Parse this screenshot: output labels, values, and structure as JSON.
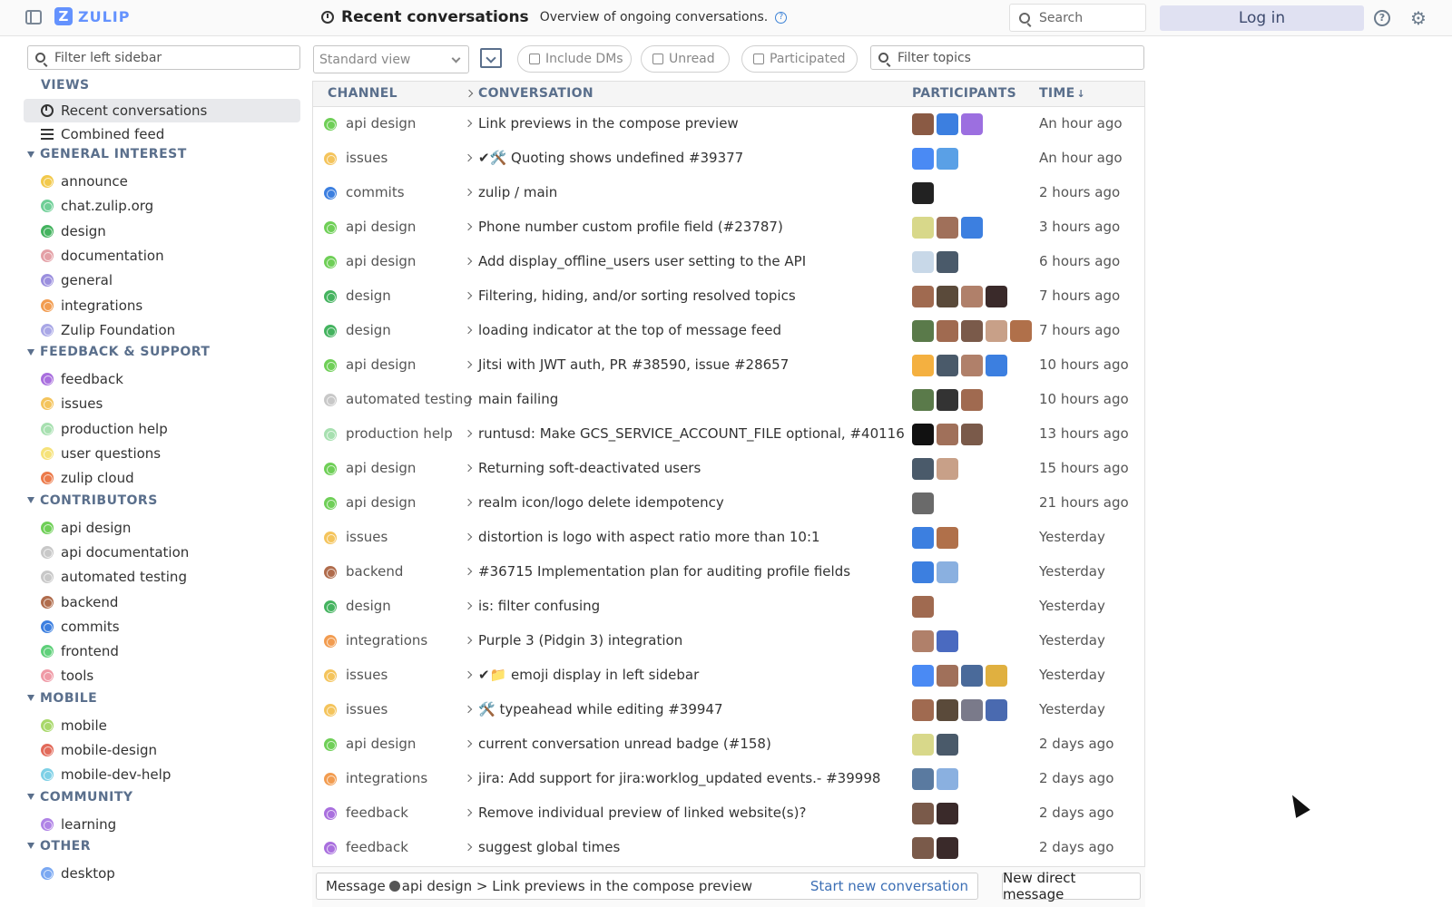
{
  "header": {
    "logo_text": "ZULIP",
    "title": "Recent conversations",
    "description": "Overview of ongoing conversations.",
    "help_icon": "?",
    "search_placeholder": "Search",
    "login_label": "Log in"
  },
  "sidebar": {
    "filter_placeholder": "Filter left sidebar",
    "views_label": "VIEWS",
    "views": [
      {
        "label": "Recent conversations",
        "icon": "clock-icon"
      },
      {
        "label": "Combined feed",
        "icon": "feed-icon"
      }
    ],
    "sections": [
      {
        "label": "GENERAL INTEREST",
        "items": [
          {
            "label": "announce",
            "color": "#f2c94c"
          },
          {
            "label": "chat.zulip.org",
            "color": "#6fcf97"
          },
          {
            "label": "design",
            "color": "#44b35f"
          },
          {
            "label": "documentation",
            "color": "#e4a0a6"
          },
          {
            "label": "general",
            "color": "#9b8fde"
          },
          {
            "label": "integrations",
            "color": "#f29c50"
          },
          {
            "label": "Zulip Foundation",
            "color": "#a9a7e6"
          }
        ]
      },
      {
        "label": "FEEDBACK & SUPPORT",
        "items": [
          {
            "label": "feedback",
            "color": "#a96fde"
          },
          {
            "label": "issues",
            "color": "#f4c45c"
          },
          {
            "label": "production help",
            "color": "#a7e0b0"
          },
          {
            "label": "user questions",
            "color": "#f6e27a"
          },
          {
            "label": "zulip cloud",
            "color": "#ec7a4a"
          }
        ]
      },
      {
        "label": "CONTRIBUTORS",
        "items": [
          {
            "label": "api design",
            "color": "#6fcf57"
          },
          {
            "label": "api documentation",
            "color": "#c8c8c8"
          },
          {
            "label": "automated testing",
            "color": "#c8c8c8"
          },
          {
            "label": "backend",
            "color": "#b06c4c"
          },
          {
            "label": "commits",
            "color": "#3c7fe0"
          },
          {
            "label": "frontend",
            "color": "#5fd07a"
          },
          {
            "label": "tools",
            "color": "#ef9aa6"
          }
        ]
      },
      {
        "label": "MOBILE",
        "items": [
          {
            "label": "mobile",
            "color": "#a8d86a"
          },
          {
            "label": "mobile-design",
            "color": "#e26a5a"
          },
          {
            "label": "mobile-dev-help",
            "color": "#7ed0e6"
          }
        ]
      },
      {
        "label": "COMMUNITY",
        "items": [
          {
            "label": "learning",
            "color": "#b083e6"
          }
        ]
      },
      {
        "label": "OTHER",
        "items": [
          {
            "label": "desktop",
            "color": "#7aa8f2"
          }
        ]
      }
    ]
  },
  "filters": {
    "view_select": "Standard view",
    "include_dms": "Include DMs",
    "unread": "Unread",
    "participated": "Participated",
    "topic_placeholder": "Filter topics"
  },
  "table": {
    "headers": {
      "channel": "CHANNEL",
      "conversation": "CONVERSATION",
      "participants": "PARTICIPANTS",
      "time": "TIME"
    },
    "rows": [
      {
        "channel": "api design",
        "color": "#6fcf57",
        "topic": "Link previews in the compose preview",
        "time": "An hour ago",
        "avatars": [
          "#8a5a44",
          "#3c7fe0",
          "#9c6fe0"
        ]
      },
      {
        "channel": "issues",
        "color": "#f4c45c",
        "topic": "✔🛠️ Quoting shows undefined #39377",
        "time": "An hour ago",
        "avatars": [
          "#4a8af4",
          "#5aa0e6"
        ]
      },
      {
        "channel": "commits",
        "color": "#3c7fe0",
        "topic": "zulip / main",
        "time": "2 hours ago",
        "avatars": [
          "#222222"
        ]
      },
      {
        "channel": "api design",
        "color": "#6fcf57",
        "topic": "Phone number custom profile field (#23787)",
        "time": "3 hours ago",
        "avatars": [
          "#d8d88a",
          "#a0705a",
          "#3c7fe0"
        ]
      },
      {
        "channel": "api design",
        "color": "#6fcf57",
        "topic": "Add display_offline_users user setting to the API",
        "time": "6 hours ago",
        "avatars": [
          "#c8d8e8",
          "#4a5a6a"
        ]
      },
      {
        "channel": "design",
        "color": "#44b35f",
        "topic": "Filtering, hiding, and/or sorting resolved topics",
        "time": "7 hours ago",
        "avatars": [
          "#a06a50",
          "#5a4a3a",
          "#b0806a",
          "#3a2a2a"
        ]
      },
      {
        "channel": "design",
        "color": "#44b35f",
        "topic": "loading indicator at the top of message feed",
        "time": "7 hours ago",
        "avatars": [
          "#5a7a4a",
          "#a06a50",
          "#7a5a4a",
          "#c8a088",
          "#b0704a"
        ]
      },
      {
        "channel": "api design",
        "color": "#6fcf57",
        "topic": "Jitsi with JWT auth, PR #38590, issue #28657",
        "time": "10 hours ago",
        "avatars": [
          "#f4b040",
          "#4a5a6a",
          "#b0806a",
          "#3c7fe0"
        ]
      },
      {
        "channel": "automated testing",
        "color": "#c8c8c8",
        "topic": "main failing",
        "time": "10 hours ago",
        "avatars": [
          "#5a7a4a",
          "#333333",
          "#a06a50"
        ]
      },
      {
        "channel": "production help",
        "color": "#a7e0b0",
        "topic": "runtusd: Make GCS_SERVICE_ACCOUNT_FILE optional, #40116",
        "time": "13 hours ago",
        "avatars": [
          "#111111",
          "#a0705a",
          "#7a5a4a"
        ]
      },
      {
        "channel": "api design",
        "color": "#6fcf57",
        "topic": "Returning soft-deactivated users",
        "time": "15 hours ago",
        "avatars": [
          "#4a5a6a",
          "#c8a088"
        ]
      },
      {
        "channel": "api design",
        "color": "#6fcf57",
        "topic": "realm icon/logo delete idempotency",
        "time": "21 hours ago",
        "avatars": [
          "#6a6a6a"
        ]
      },
      {
        "channel": "issues",
        "color": "#f4c45c",
        "topic": "distortion is logo with aspect ratio more than 10:1",
        "time": "Yesterday",
        "avatars": [
          "#3c7fe0",
          "#b0704a"
        ]
      },
      {
        "channel": "backend",
        "color": "#b06c4c",
        "topic": "#36715 Implementation plan for auditing profile fields",
        "time": "Yesterday",
        "avatars": [
          "#3c7fe0",
          "#8ab0e0"
        ]
      },
      {
        "channel": "design",
        "color": "#44b35f",
        "topic": "is: filter confusing",
        "time": "Yesterday",
        "avatars": [
          "#a06a50"
        ]
      },
      {
        "channel": "integrations",
        "color": "#f29c50",
        "topic": "Purple 3 (Pidgin 3) integration",
        "time": "Yesterday",
        "avatars": [
          "#b0806a",
          "#4a6ac0"
        ]
      },
      {
        "channel": "issues",
        "color": "#f4c45c",
        "topic": "✔📁 emoji display in left sidebar",
        "time": "Yesterday",
        "avatars": [
          "#4a8af4",
          "#a0705a",
          "#4a6a9a",
          "#e0b040"
        ]
      },
      {
        "channel": "issues",
        "color": "#f4c45c",
        "topic": "🛠️ typeahead while editing #39947",
        "time": "Yesterday",
        "avatars": [
          "#a06a50",
          "#5a4a3a",
          "#7a7a8a",
          "#4a6ab0"
        ]
      },
      {
        "channel": "api design",
        "color": "#6fcf57",
        "topic": "current conversation unread badge (#158)",
        "time": "2 days ago",
        "avatars": [
          "#d8d88a",
          "#4a5a6a"
        ]
      },
      {
        "channel": "integrations",
        "color": "#f29c50",
        "topic": "jira: Add support for jira:worklog_updated events.- #39998",
        "time": "2 days ago",
        "avatars": [
          "#5a7aa0",
          "#8ab0e0"
        ]
      },
      {
        "channel": "feedback",
        "color": "#a96fde",
        "topic": "Remove individual preview of linked website(s)?",
        "time": "2 days ago",
        "avatars": [
          "#7a5a4a",
          "#3a2a2a"
        ]
      },
      {
        "channel": "feedback",
        "color": "#a96fde",
        "topic": "suggest global times",
        "time": "2 days ago",
        "avatars": [
          "#7a5a4a",
          "#3a2a2a"
        ]
      }
    ]
  },
  "compose": {
    "message_prefix": "Message",
    "message_target": "api design > Link previews in the compose preview",
    "start_new": "Start new conversation",
    "new_dm": "New direct message"
  }
}
